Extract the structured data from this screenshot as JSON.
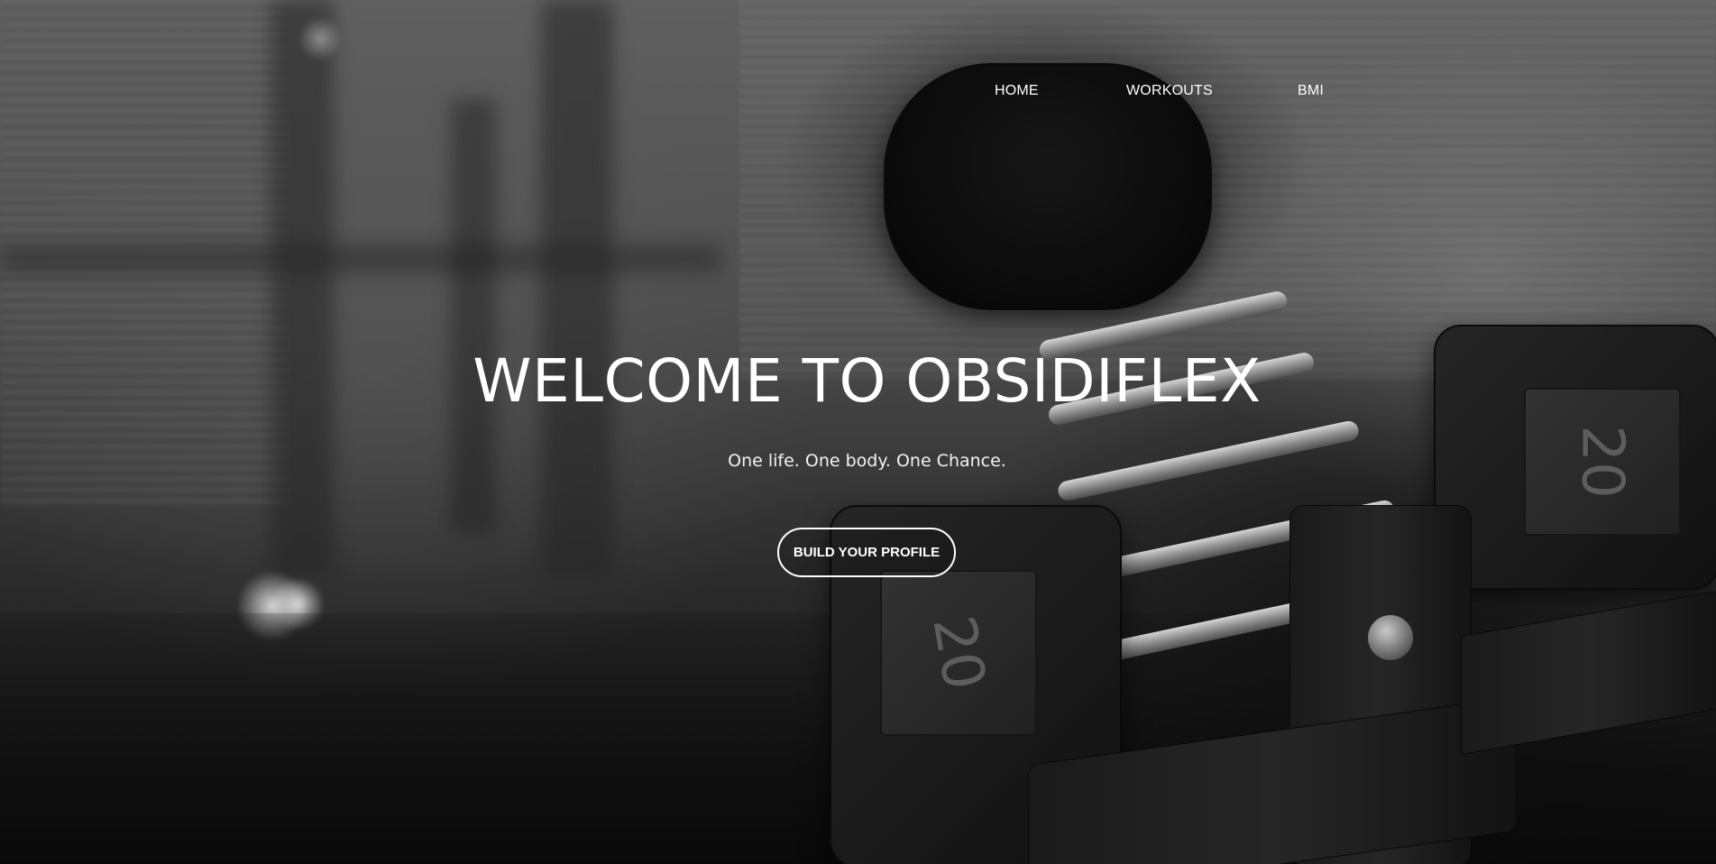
{
  "nav": {
    "items": [
      {
        "label": "HOME"
      },
      {
        "label": "WORKOUTS"
      },
      {
        "label": "BMI"
      }
    ]
  },
  "hero": {
    "title": "WELCOME TO OBSIDIFLEX",
    "subtitle": "One life. One body. One Chance.",
    "cta_label": "BUILD YOUR PROFILE",
    "background": {
      "plate_number": "20",
      "tone": "grayscale"
    }
  },
  "colors": {
    "text": "#ffffff",
    "button_border": "#ffffff"
  }
}
